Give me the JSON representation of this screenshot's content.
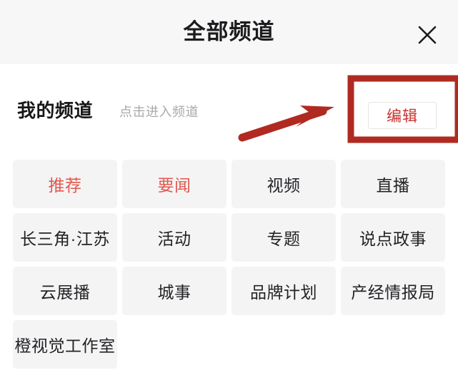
{
  "header": {
    "title": "全部频道",
    "close_icon": "close-icon"
  },
  "my_channels": {
    "title": "我的频道",
    "hint": "点击进入频道",
    "edit_label": "编辑"
  },
  "annotation": {
    "arrow_icon": "arrow-right-up-icon",
    "highlight_icon": "highlight-rectangle",
    "color": "#b02a22"
  },
  "colors": {
    "header_bg": "#f7f7f8",
    "tile_bg": "#f4f4f5",
    "tile_text": "#232326",
    "tile_text_selected": "#e2574c",
    "edit_text": "#c9302c",
    "hint_text": "#a9a9ad",
    "annotation_red": "#b02a22"
  },
  "channels": [
    {
      "label": "推荐",
      "selected": true
    },
    {
      "label": "要闻",
      "selected": true
    },
    {
      "label": "视频",
      "selected": false
    },
    {
      "label": "直播",
      "selected": false
    },
    {
      "label": "长三角·江苏",
      "selected": false
    },
    {
      "label": "活动",
      "selected": false
    },
    {
      "label": "专题",
      "selected": false
    },
    {
      "label": "说点政事",
      "selected": false
    },
    {
      "label": "云展播",
      "selected": false
    },
    {
      "label": "城事",
      "selected": false
    },
    {
      "label": "品牌计划",
      "selected": false
    },
    {
      "label": "产经情报局",
      "selected": false
    },
    {
      "label": "橙视觉工作室",
      "selected": false
    }
  ]
}
